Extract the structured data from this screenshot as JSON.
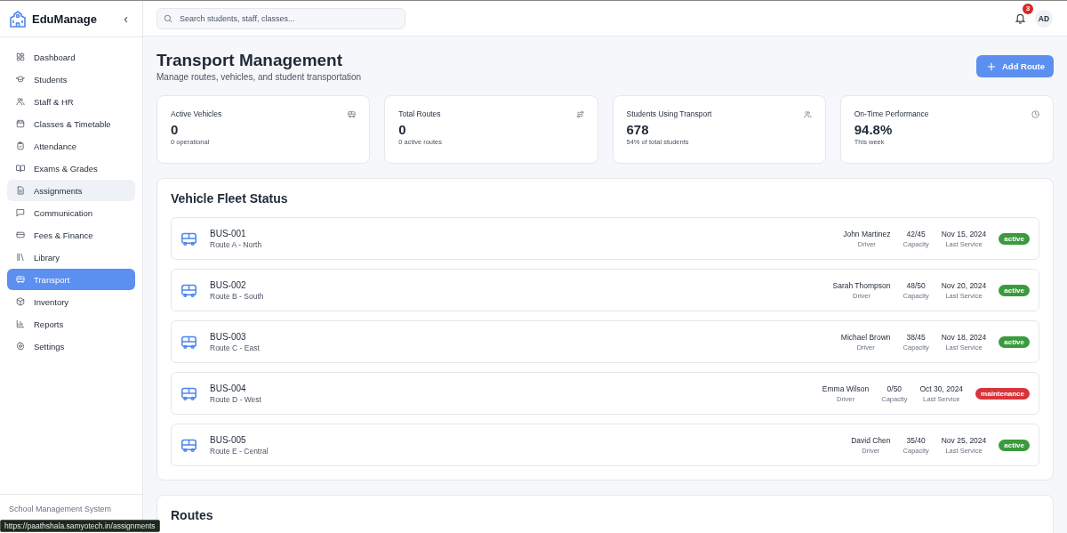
{
  "sidebar": {
    "brand": "EduManage",
    "collapse": "‹",
    "items": [
      {
        "label": "Dashboard",
        "selected": false,
        "hovered": false
      },
      {
        "label": "Students",
        "selected": false,
        "hovered": false
      },
      {
        "label": "Staff & HR",
        "selected": false,
        "hovered": false
      },
      {
        "label": "Classes & Timetable",
        "selected": false,
        "hovered": false
      },
      {
        "label": "Attendance",
        "selected": false,
        "hovered": false
      },
      {
        "label": "Exams & Grades",
        "selected": false,
        "hovered": false
      },
      {
        "label": "Assignments",
        "selected": false,
        "hovered": true
      },
      {
        "label": "Communication",
        "selected": false,
        "hovered": false
      },
      {
        "label": "Fees & Finance",
        "selected": false,
        "hovered": false
      },
      {
        "label": "Library",
        "selected": false,
        "hovered": false
      },
      {
        "label": "Transport",
        "selected": true,
        "hovered": false
      },
      {
        "label": "Inventory",
        "selected": false,
        "hovered": false
      },
      {
        "label": "Reports",
        "selected": false,
        "hovered": false
      },
      {
        "label": "Settings",
        "selected": false,
        "hovered": false
      }
    ],
    "footer": "School Management System"
  },
  "topbar": {
    "search": {
      "placeholder": "Search students, staff, classes..."
    },
    "notifications": "3",
    "avatar": "AD"
  },
  "page": {
    "title": "Transport Management",
    "subtitle": "Manage routes, vehicles, and student transportation",
    "add_button": "Add Route"
  },
  "stats": [
    {
      "label": "Active Vehicles",
      "value": "0",
      "note": "0 operational"
    },
    {
      "label": "Total Routes",
      "value": "0",
      "note": "0 active routes"
    },
    {
      "label": "Students Using Transport",
      "value": "678",
      "note": "54% of total students"
    },
    {
      "label": "On-Time Performance",
      "value": "94.8%",
      "note": "This week"
    }
  ],
  "fleet": {
    "title": "Vehicle Fleet Status",
    "vehicles": [
      {
        "id": "BUS-001",
        "route": "Route A - North",
        "driver": "John Martinez",
        "driver_label": "Driver",
        "capacity": "42/45",
        "capacity_label": "Capacity",
        "service": "Nov 15, 2024",
        "service_label": "Last Service",
        "status": "active",
        "color": "#3b9a3e"
      },
      {
        "id": "BUS-002",
        "route": "Route B - South",
        "driver": "Sarah Thompson",
        "driver_label": "Driver",
        "capacity": "48/50",
        "capacity_label": "Capacity",
        "service": "Nov 20, 2024",
        "service_label": "Last Service",
        "status": "active",
        "color": "#3b9a3e"
      },
      {
        "id": "BUS-003",
        "route": "Route C - East",
        "driver": "Michael Brown",
        "driver_label": "Driver",
        "capacity": "38/45",
        "capacity_label": "Capacity",
        "service": "Nov 18, 2024",
        "service_label": "Last Service",
        "status": "active",
        "color": "#3b9a3e"
      },
      {
        "id": "BUS-004",
        "route": "Route D - West",
        "driver": "Emma Wilson",
        "driver_label": "Driver",
        "capacity": "0/50",
        "capacity_label": "Capacity",
        "service": "Oct 30, 2024",
        "service_label": "Last Service",
        "status": "maintenance",
        "color": "#d7353a"
      },
      {
        "id": "BUS-005",
        "route": "Route E - Central",
        "driver": "David Chen",
        "driver_label": "Driver",
        "capacity": "35/40",
        "capacity_label": "Capacity",
        "service": "Nov 25, 2024",
        "service_label": "Last Service",
        "status": "active",
        "color": "#3b9a3e"
      }
    ]
  },
  "routes": {
    "title": "Routes"
  },
  "status_bar": {
    "url": "https://paathshala.samyotech.in/assignments"
  }
}
